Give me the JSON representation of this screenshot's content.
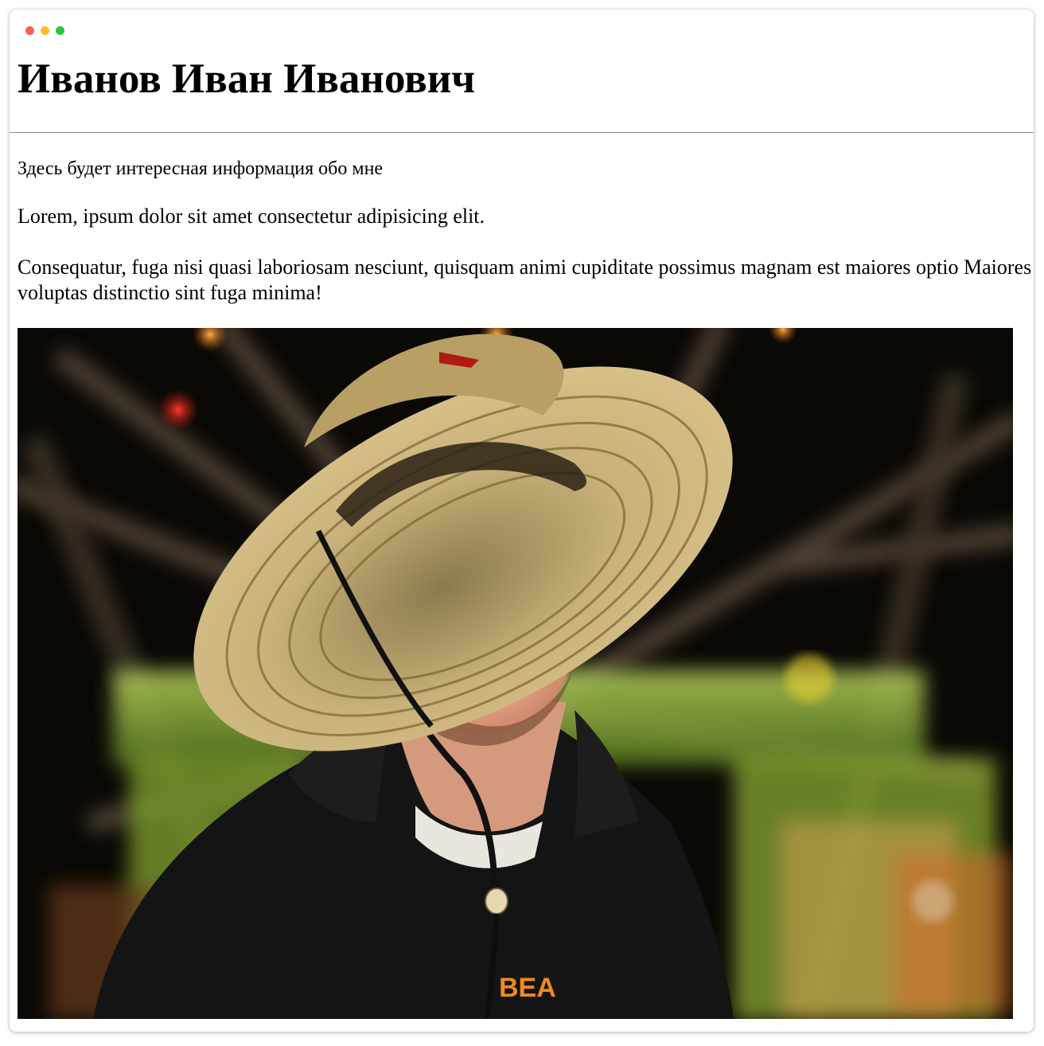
{
  "window": {
    "controls": {
      "close_color": "#ff5f57",
      "minimize_color": "#febc2e",
      "maximize_color": "#28c840"
    }
  },
  "header": {
    "title": "Иванов Иван Иванович"
  },
  "main": {
    "intro": "Здесь будет интересная информация обо мне",
    "paragraph_1": "Lorem, ipsum dolor sit amet consectetur adipisicing elit.",
    "paragraph_2": "Consequatur, fuga nisi quasi laboriosam nesciunt, quisquam animi cupiditate possimus magnam est maiores optio Maiores voluptas distinctio sint fuga minima!"
  },
  "photo": {
    "subject": "smiling man in straw hat and black hoodie in front of blurred ferris wheel",
    "hoodie_text": "BEA"
  }
}
